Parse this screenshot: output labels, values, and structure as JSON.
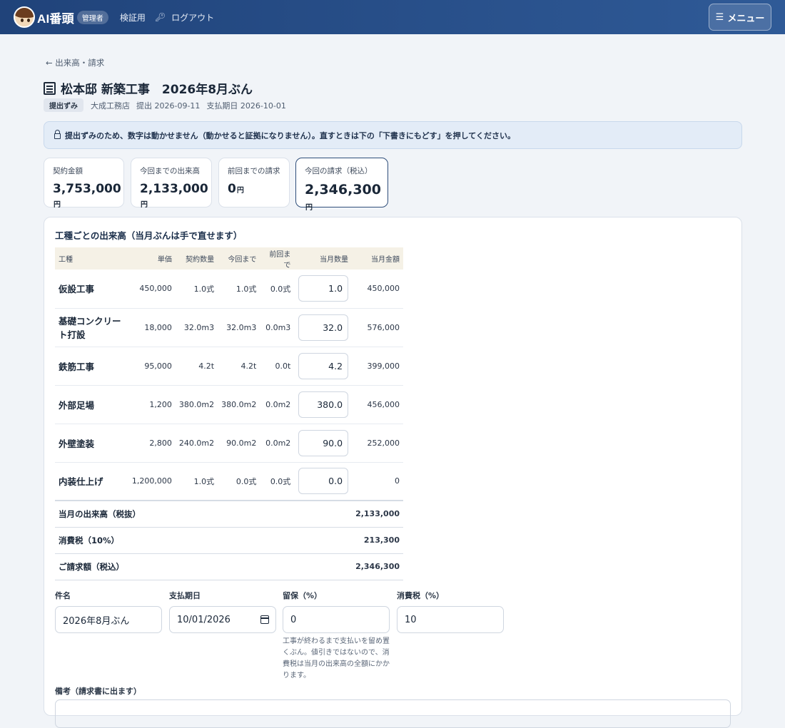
{
  "header": {
    "brand": "AI番頭",
    "role": "管理者",
    "nav_verify": "検証用",
    "nav_logout": "ログアウト",
    "menu_label": "メニュー"
  },
  "page": {
    "back_link": "← 出来高・請求",
    "title": "松本邸 新築工事　2026年8月ぶん",
    "status": "提出ずみ",
    "contractor": "大成工務店",
    "submitted": "提出 2026-09-11",
    "due": "支払期日 2026-10-01",
    "notice": "提出ずみのため、数字は動かせません（動かせると証拠になりません）。直すときは下の「下書きにもどす」を押してください。"
  },
  "stats": [
    {
      "label": "契約金額",
      "value": "3,753,000",
      "unit": "円"
    },
    {
      "label": "今回までの出来高",
      "value": "2,133,000",
      "unit": "円"
    },
    {
      "label": "前回までの請求",
      "value": "0",
      "unit": "円"
    },
    {
      "label": "今回の請求（税込）",
      "value": "2,346,300",
      "unit": "円"
    }
  ],
  "table": {
    "title": "工種ごとの出来高（当月ぶんは手で直せます）",
    "headers": [
      "工種",
      "単価",
      "契約数量",
      "今回まで",
      "前回まで",
      "当月数量",
      "当月金額"
    ],
    "rows": [
      {
        "name": "仮設工事",
        "unit_price": "450,000",
        "contract_qty": "1.0式",
        "to_date": "1.0式",
        "prev": "0.0式",
        "month_qty": "1.0",
        "amount": "450,000"
      },
      {
        "name": "基礎コンクリート打設",
        "unit_price": "18,000",
        "contract_qty": "32.0m3",
        "to_date": "32.0m3",
        "prev": "0.0m3",
        "month_qty": "32.0",
        "amount": "576,000"
      },
      {
        "name": "鉄筋工事",
        "unit_price": "95,000",
        "contract_qty": "4.2t",
        "to_date": "4.2t",
        "prev": "0.0t",
        "month_qty": "4.2",
        "amount": "399,000"
      },
      {
        "name": "外部足場",
        "unit_price": "1,200",
        "contract_qty": "380.0m2",
        "to_date": "380.0m2",
        "prev": "0.0m2",
        "month_qty": "380.0",
        "amount": "456,000"
      },
      {
        "name": "外壁塗装",
        "unit_price": "2,800",
        "contract_qty": "240.0m2",
        "to_date": "90.0m2",
        "prev": "0.0m2",
        "month_qty": "90.0",
        "amount": "252,000"
      },
      {
        "name": "内装仕上げ",
        "unit_price": "1,200,000",
        "contract_qty": "1.0式",
        "to_date": "0.0式",
        "prev": "0.0式",
        "month_qty": "0.0",
        "amount": "0"
      }
    ],
    "summary": [
      {
        "label": "当月の出来高（税抜）",
        "value": "2,133,000"
      },
      {
        "label": "消費税（10%）",
        "value": "213,300"
      },
      {
        "label": "ご請求額（税込）",
        "value": "2,346,300"
      }
    ]
  },
  "form": {
    "subject_label": "件名",
    "subject_value": "2026年8月ぶん",
    "due_label": "支払期日",
    "due_value": "10/01/2026",
    "retention_label": "留保（%）",
    "retention_value": "0",
    "retention_hint": "工事が終わるまで支払いを留め置くぶん。値引きではないので、消費税は当月の出来高の全額にかかります。",
    "tax_label": "消費税（%）",
    "tax_value": "10",
    "remarks_label": "備考（請求書に出ます）"
  }
}
